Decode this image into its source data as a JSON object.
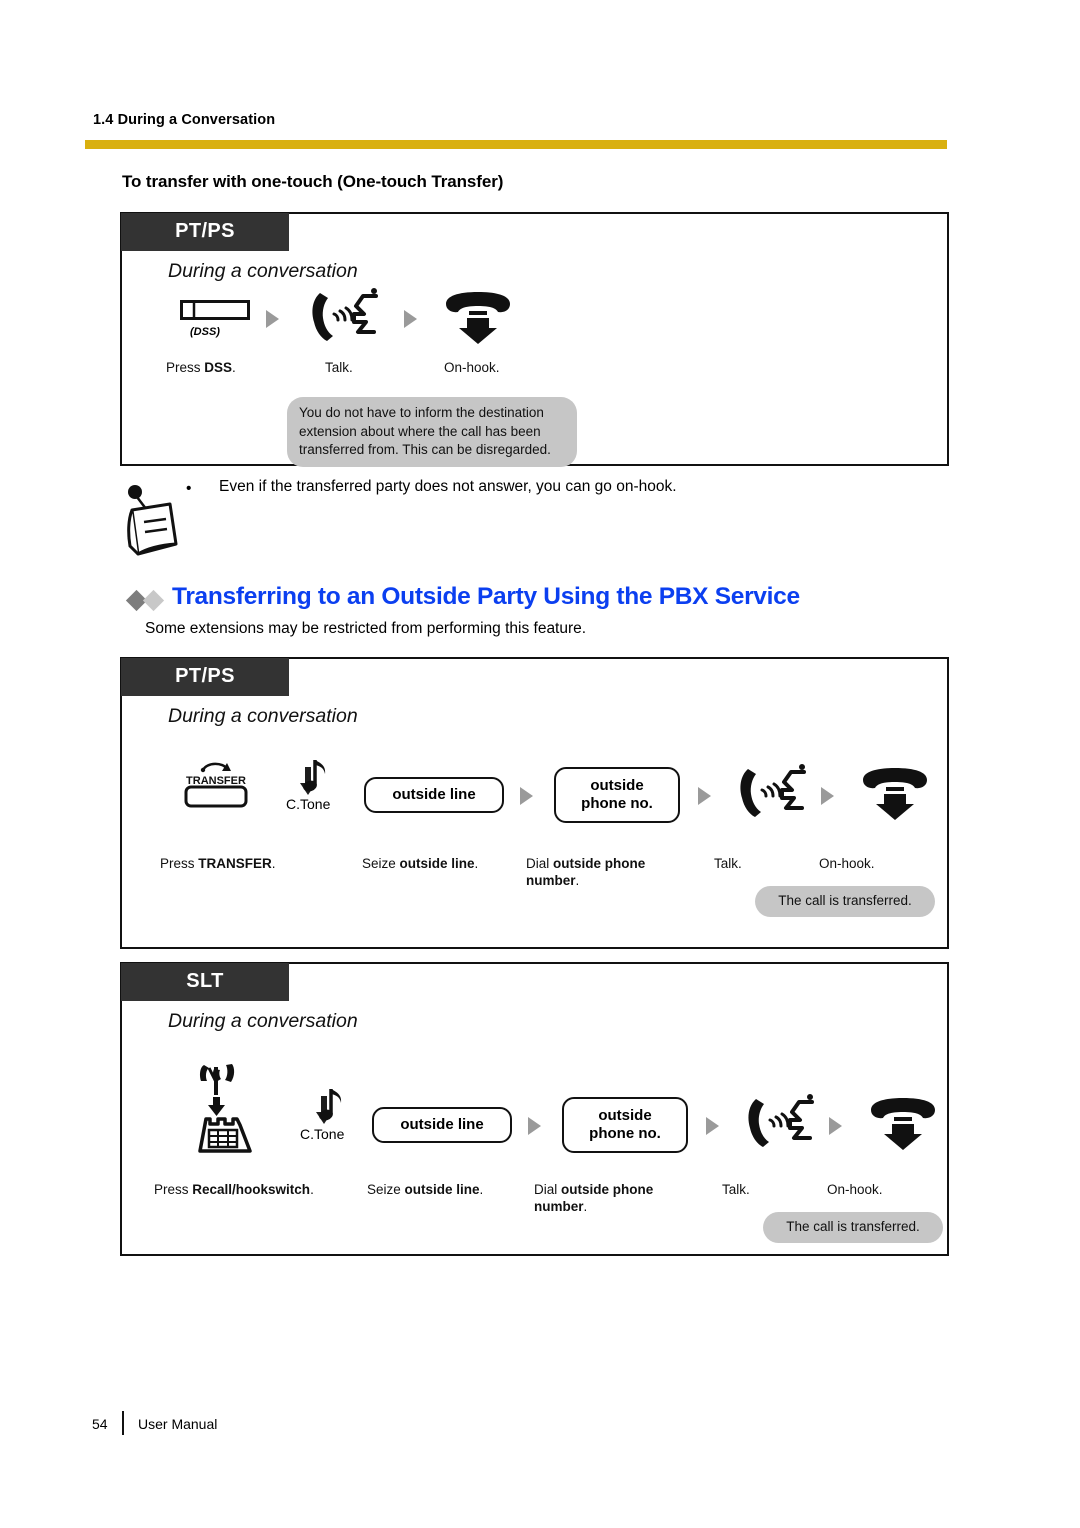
{
  "header": {
    "running_head": "1.4 During a Conversation",
    "rule_color": "#d9b010"
  },
  "section": {
    "title": "To transfer with one-touch (One-touch Transfer)"
  },
  "panel_one": {
    "tab_label": "PT/PS",
    "subtitle": "During a conversation",
    "icons": {
      "dss_label": "(DSS)",
      "dss_icon": "dss-button-icon",
      "talk_icon": "handset-talking-icon",
      "onhook_icon": "handset-onhook-down-arrow-icon"
    },
    "captions": [
      {
        "prefix": "Press ",
        "bold": "DSS",
        "suffix": "."
      },
      {
        "prefix": "",
        "bold": "",
        "suffix": "Talk."
      },
      {
        "prefix": "",
        "bold": "",
        "suffix": "On-hook."
      }
    ],
    "balloon": "You do not have to inform the destination extension about where the call has been transferred from. This can be disregarded."
  },
  "note": {
    "icon": "memo-pushpin-icon",
    "bullet": "•",
    "text": "Even if the transferred party does not answer, you can go on-hook."
  },
  "blue_section": {
    "diamond_dark": "#7d7d7d",
    "diamond_light": "#c8c8c8",
    "heading_color": "#0b3ff0",
    "heading": "Transferring to an Outside Party Using the PBX Service",
    "intro": "Some extensions may be restricted from performing this feature."
  },
  "panel_two": {
    "tab_label": "PT/PS",
    "subtitle": "During a conversation",
    "icons": {
      "transfer_label": "TRANSFER",
      "transfer_icon": "transfer-button-icon",
      "ctone_label": "C.Tone",
      "ctone_icon": "confirmation-tone-note-icon",
      "talk_icon": "handset-talking-icon",
      "onhook_icon": "handset-onhook-down-arrow-icon"
    },
    "pills": [
      {
        "line1": "outside line",
        "line2": ""
      },
      {
        "line1": "outside",
        "line2": "phone no."
      }
    ],
    "captions": [
      {
        "prefix": "Press ",
        "bold": "TRANSFER",
        "suffix": "."
      },
      {
        "prefix": "Seize ",
        "bold": "outside line",
        "suffix": "."
      },
      {
        "prefix": "Dial ",
        "bold": "outside phone number",
        "suffix": "."
      },
      {
        "prefix": "",
        "bold": "",
        "suffix": "Talk."
      },
      {
        "prefix": "",
        "bold": "",
        "suffix": "On-hook."
      }
    ],
    "balloon": "The call is transferred."
  },
  "panel_three": {
    "tab_label": "SLT",
    "subtitle": "During a conversation",
    "icons": {
      "hookswitch_icon": "recall-hookswitch-icon",
      "ctone_label": "C.Tone",
      "ctone_icon": "confirmation-tone-note-icon",
      "talk_icon": "handset-talking-icon",
      "onhook_icon": "handset-onhook-down-arrow-icon"
    },
    "pills": [
      {
        "line1": "outside line",
        "line2": ""
      },
      {
        "line1": "outside",
        "line2": "phone no."
      }
    ],
    "captions": [
      {
        "prefix": "Press ",
        "bold": "Recall/hookswitch",
        "suffix": "."
      },
      {
        "prefix": "Seize ",
        "bold": "outside line",
        "suffix": "."
      },
      {
        "prefix": "Dial ",
        "bold": "outside phone number",
        "suffix": "."
      },
      {
        "prefix": "",
        "bold": "",
        "suffix": "Talk."
      },
      {
        "prefix": "",
        "bold": "",
        "suffix": "On-hook."
      }
    ],
    "balloon": "The call is transferred."
  },
  "footer": {
    "page_number": "54",
    "doc_title": "User Manual"
  }
}
